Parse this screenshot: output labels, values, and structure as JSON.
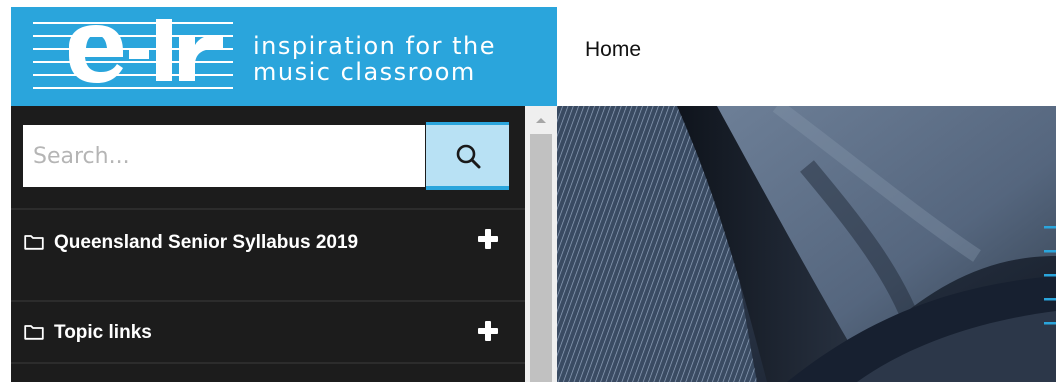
{
  "logo": {
    "mark_text": "e-lr",
    "tagline_line1": "inspiration for the",
    "tagline_line2": "music classroom",
    "brand_color": "#2aa5dc"
  },
  "header": {
    "title": "Home"
  },
  "search": {
    "placeholder": "Search...",
    "value": "",
    "button_icon": "search-icon",
    "button_color": "#b8e1f4"
  },
  "sidebar": {
    "background": "#1c1c1c",
    "items": [
      {
        "label": "Queensland Senior Syllabus 2019",
        "icon": "folder-icon",
        "expand_icon": "plus-icon"
      },
      {
        "label": "Topic links",
        "icon": "folder-icon",
        "expand_icon": "plus-icon"
      }
    ]
  },
  "hero": {
    "icon": "hero-image"
  }
}
